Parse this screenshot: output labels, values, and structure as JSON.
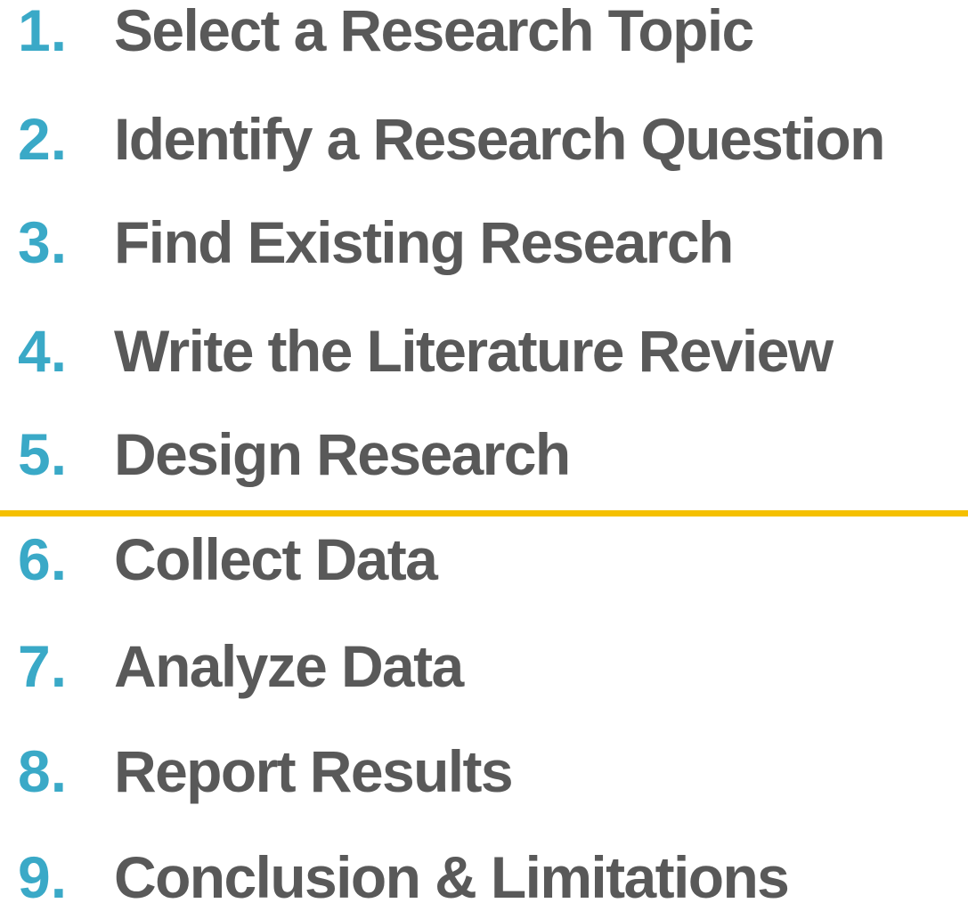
{
  "steps": [
    {
      "number": "1.",
      "label": "Select a Research Topic"
    },
    {
      "number": "2.",
      "label": "Identify a Research Question"
    },
    {
      "number": "3.",
      "label": "Find Existing Research"
    },
    {
      "number": "4.",
      "label": "Write the Literature Review"
    },
    {
      "number": "5.",
      "label": "Design Research"
    },
    {
      "number": "6.",
      "label": "Collect Data"
    },
    {
      "number": "7.",
      "label": "Analyze Data"
    },
    {
      "number": "8.",
      "label": "Report Results"
    },
    {
      "number": "9.",
      "label": "Conclusion & Limitations"
    }
  ],
  "colors": {
    "number": "#3aa9c7",
    "label": "#595959",
    "divider": "#f5c000"
  }
}
